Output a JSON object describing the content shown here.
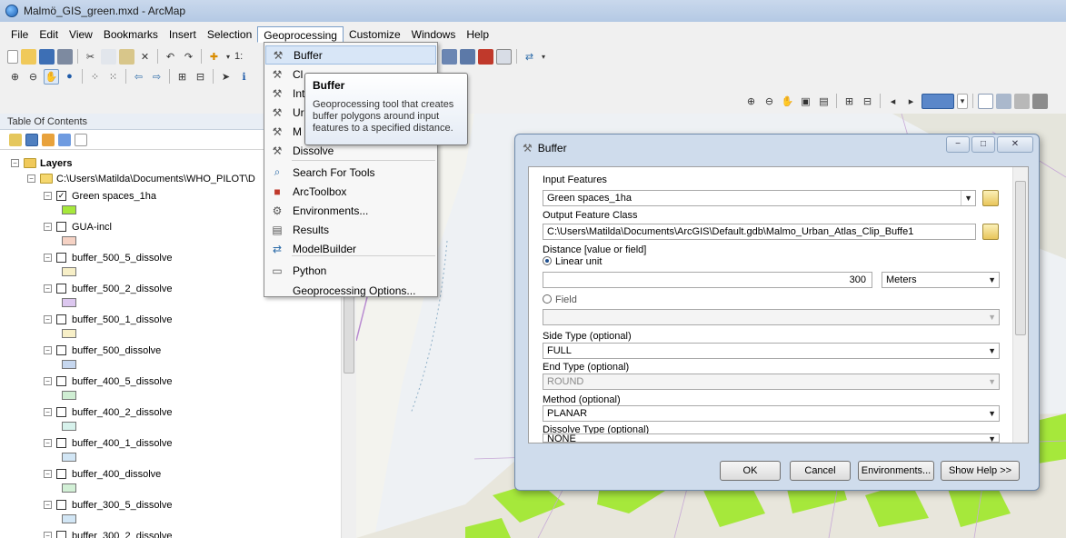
{
  "window": {
    "title": "Malmö_GIS_green.mxd - ArcMap"
  },
  "menubar": {
    "items": [
      "File",
      "Edit",
      "View",
      "Bookmarks",
      "Insert",
      "Selection",
      "Geoprocessing",
      "Customize",
      "Windows",
      "Help"
    ]
  },
  "toolbar": {
    "scale_text": "1:"
  },
  "toc": {
    "header": "Table Of Contents",
    "root_label": "Layers",
    "path": "C:\\Users\\Matilda\\Documents\\WHO_PILOT\\D"
  },
  "layers": [
    {
      "name": "Green spaces_1ha",
      "checked": "✓",
      "color": "#a6e83b"
    },
    {
      "name": "GUA-incl",
      "checked": "",
      "color": "#f5d2c4"
    },
    {
      "name": "buffer_500_5_dissolve",
      "checked": "",
      "color": "#f7efc7"
    },
    {
      "name": "buffer_500_2_dissolve",
      "checked": "",
      "color": "#dcc7ef"
    },
    {
      "name": "buffer_500_1_dissolve",
      "checked": "",
      "color": "#f7efc7"
    },
    {
      "name": "buffer_500_dissolve",
      "checked": "",
      "color": "#c6d7ef"
    },
    {
      "name": "buffer_400_5_dissolve",
      "checked": "",
      "color": "#cfeed3"
    },
    {
      "name": "buffer_400_2_dissolve",
      "checked": "",
      "color": "#d7f2ec"
    },
    {
      "name": "buffer_400_1_dissolve",
      "checked": "",
      "color": "#d2e6f5"
    },
    {
      "name": "buffer_400_dissolve",
      "checked": "",
      "color": "#d2f0d6"
    },
    {
      "name": "buffer_300_5_dissolve",
      "checked": "",
      "color": "#d2e6f5"
    },
    {
      "name": "buffer_300_2_dissolve",
      "checked": "",
      "color": "#d2f0d6"
    }
  ],
  "geoprocessing_menu": {
    "items": [
      {
        "label": "Buffer",
        "icon": "hammer-icon"
      },
      {
        "label": "Cl",
        "icon": "hammer-icon"
      },
      {
        "label": "Int",
        "icon": "hammer-icon"
      },
      {
        "label": "Ur",
        "icon": "hammer-icon"
      },
      {
        "label": "M",
        "icon": "hammer-icon"
      },
      {
        "label": "Dissolve",
        "icon": "hammer-icon"
      },
      {
        "label": "Search For Tools",
        "icon": "search-window-icon"
      },
      {
        "label": "ArcToolbox",
        "icon": "toolbox-icon"
      },
      {
        "label": "Environments...",
        "icon": "wrench-icon"
      },
      {
        "label": "Results",
        "icon": "results-icon"
      },
      {
        "label": "ModelBuilder",
        "icon": "modelbuilder-icon"
      },
      {
        "label": "Python",
        "icon": "python-window-icon"
      },
      {
        "label": "Geoprocessing Options...",
        "icon": ""
      }
    ]
  },
  "tooltip": {
    "title": "Buffer",
    "body": "Geoprocessing tool that creates buffer polygons around input features to a specified distance."
  },
  "dialog": {
    "title": "Buffer",
    "input_features_label": "Input Features",
    "input_features_value": "Green spaces_1ha",
    "output_label": "Output Feature Class",
    "output_value": "C:\\Users\\Matilda\\Documents\\ArcGIS\\Default.gdb\\Malmo_Urban_Atlas_Clip_Buffe1",
    "distance_label": "Distance [value or field]",
    "linear_unit_label": "Linear unit",
    "distance_value": "300",
    "distance_unit": "Meters",
    "field_label": "Field",
    "side_type_label": "Side Type (optional)",
    "side_type_value": "FULL",
    "end_type_label": "End Type (optional)",
    "end_type_value": "ROUND",
    "method_label": "Method (optional)",
    "method_value": "PLANAR",
    "dissolve_label": "Dissolve Type (optional)",
    "dissolve_value": "NONE",
    "ok": "OK",
    "cancel": "Cancel",
    "environments": "Environments...",
    "show_help": "Show Help >>"
  },
  "colors": {
    "selection": "#d8e6f7",
    "map_green": "#a6e83b"
  }
}
